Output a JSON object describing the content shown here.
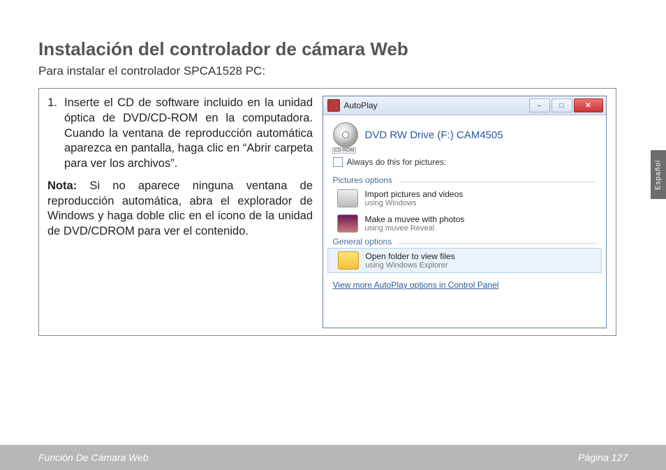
{
  "page": {
    "title": "Instalación del controlador de cámara Web",
    "subtitle": "Para instalar el controlador SPCA1528 PC:",
    "step_num": "1.",
    "step_text": "Inserte el CD de software incluido en la unidad óptica de DVD/CD-ROM en la computadora. Cuando la ventana de reproducción automática aparezca en pantalla, haga clic en “Abrir carpeta para ver los archivos”.",
    "note_label": "Nota:",
    "note_text": " Si no aparece ninguna ventana de reproducción automática, abra el explorador de Windows y haga doble clic en el icono de la unidad de DVD/CDROM para ver el contenido."
  },
  "autoplay": {
    "window_title": "AutoPlay",
    "drive_label": "DVD RW Drive (F:) CAM4505",
    "cd_caption": "CD-ROM",
    "checkbox_label": "Always do this for pictures:",
    "group_pictures": "Pictures options",
    "group_general": "General options",
    "opt_import_t1": "Import pictures and videos",
    "opt_import_t2": "using Windows",
    "opt_muvee_t1": "Make a muvee with photos",
    "opt_muvee_t2": "using muvee Reveal",
    "opt_folder_t1": "Open folder to view files",
    "opt_folder_t2": "using Windows Explorer",
    "more_link": "View more AutoPlay options in Control Panel",
    "btn_min": "–",
    "btn_max": "□",
    "btn_close": "✕"
  },
  "side_tab": "Español",
  "footer": {
    "left": "Función De Cámara Web",
    "right": "Página 127"
  }
}
